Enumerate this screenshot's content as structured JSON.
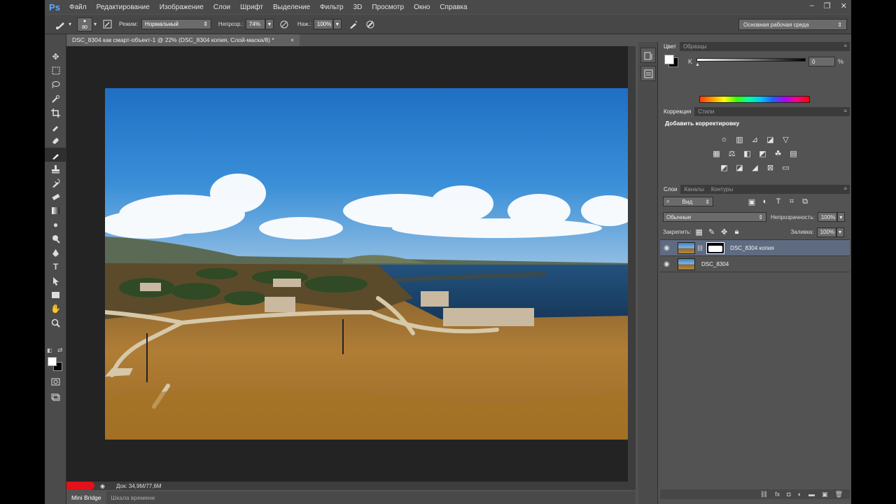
{
  "app": {
    "logo": "Ps",
    "menu": [
      "Файл",
      "Редактирование",
      "Изображение",
      "Слои",
      "Шрифт",
      "Выделение",
      "Фильтр",
      "3D",
      "Просмотр",
      "Окно",
      "Справка"
    ],
    "window_controls": [
      "‒",
      "❐",
      "✕"
    ]
  },
  "options_bar": {
    "brush_size": "80",
    "mode_label": "Режим:",
    "mode_value": "Нормальный",
    "opacity_label": "Непрозр.:",
    "opacity_value": "74%",
    "pressure_label": "Наж.:",
    "pressure_value": "100%",
    "workspace": "Основная рабочая среда"
  },
  "document": {
    "tab_title": "DSC_8304 как смарт-объект-1 @ 22% (DSC_8304 копия, Слой-маска/8) *",
    "close_glyph": "×",
    "status": "Док: 34,9M/77,6M"
  },
  "bottom_tabs": [
    "Mini Bridge",
    "Шкала времени"
  ],
  "color_panel": {
    "tabs": [
      "Цвет",
      "Образцы"
    ],
    "channel_label": "K",
    "value": "0",
    "unit": "%"
  },
  "adjustments_panel": {
    "tabs": [
      "Коррекция",
      "Стили"
    ],
    "title": "Добавить корректировку"
  },
  "layers_panel": {
    "tabs": [
      "Слои",
      "Каналы",
      "Контуры"
    ],
    "filter_kind": "Вид",
    "blend_mode": "Обычные",
    "opacity_label": "Непрозрачность:",
    "opacity_value": "100%",
    "lock_label": "Закрепить:",
    "fill_label": "Заливка:",
    "fill_value": "100%",
    "layers": [
      {
        "name": "DSC_8304 копия",
        "selected": true,
        "has_mask": true
      },
      {
        "name": "DSC_8304",
        "selected": false,
        "has_mask": false
      }
    ]
  },
  "colors": {
    "foreground": "#ffffff",
    "background": "#000000",
    "selected_layer": "#5f6b80"
  }
}
